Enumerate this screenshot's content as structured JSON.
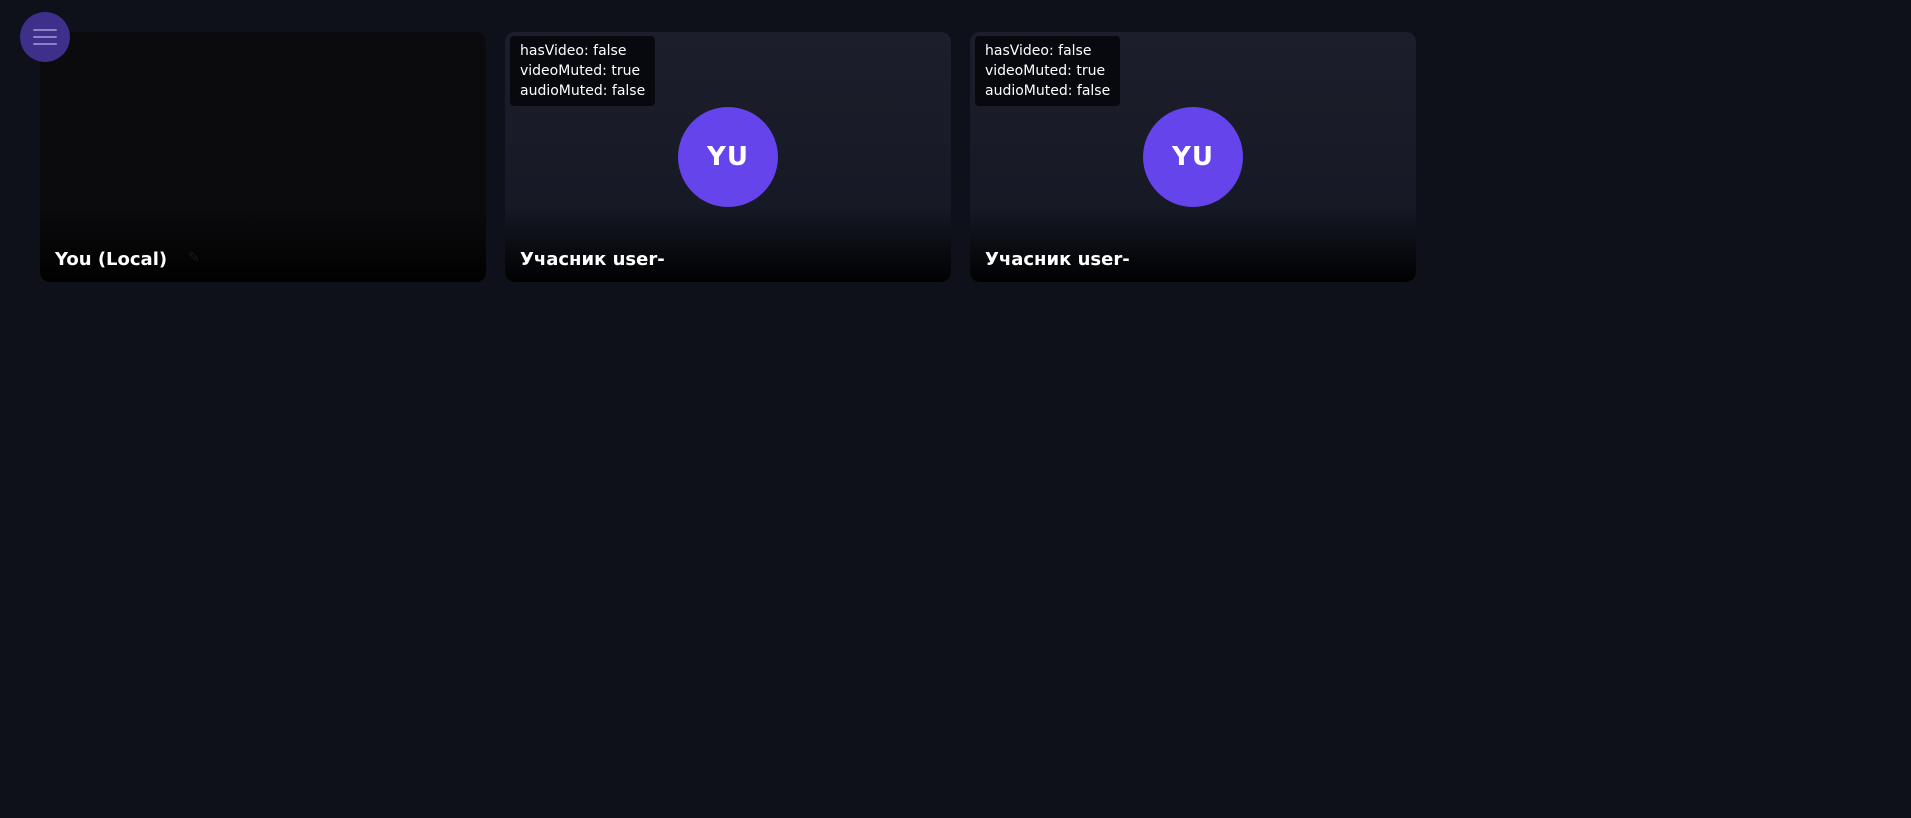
{
  "menu": {
    "icon": "hamburger-menu-icon"
  },
  "tiles": [
    {
      "name": "You (Local)",
      "icon": "pencil-icon"
    },
    {
      "name": "Учасник user-",
      "initials": "YU",
      "debug": {
        "has_video": "hasVideo: false",
        "video_muted": "videoMuted: true",
        "audio_muted": "audioMuted: false"
      }
    },
    {
      "name": "Учасник user-",
      "initials": "YU",
      "debug": {
        "has_video": "hasVideo: false",
        "video_muted": "videoMuted: true",
        "audio_muted": "audioMuted: false"
      }
    }
  ],
  "colors": {
    "background": "#0e1119",
    "accent": "#6544ec",
    "menu_button": "#3d2f8a"
  }
}
